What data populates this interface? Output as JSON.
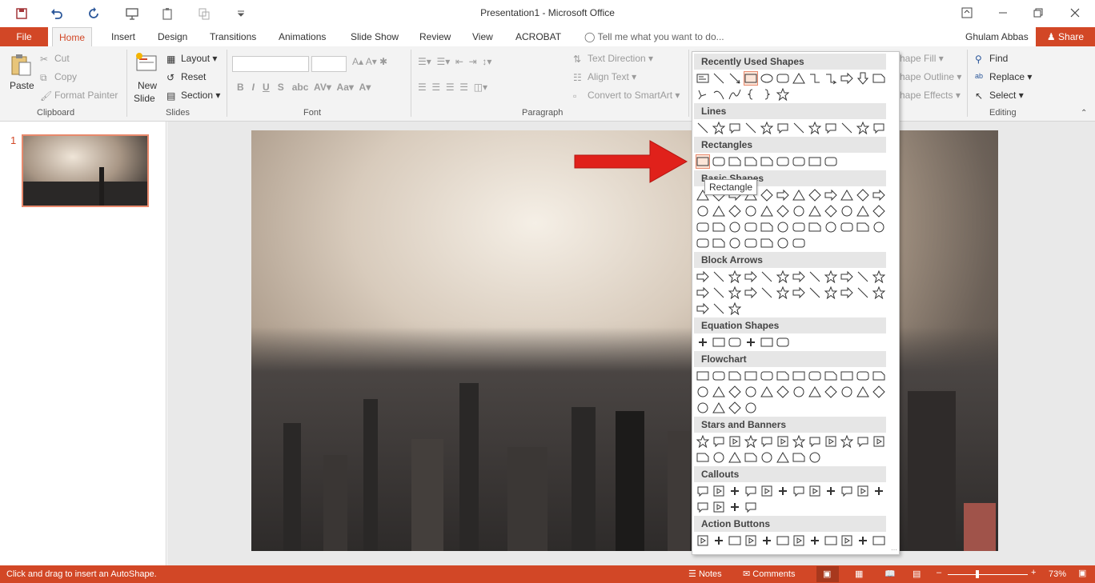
{
  "window": {
    "title": "Presentation1 - Microsoft Office",
    "user": "Ghulam Abbas",
    "share_label": "Share"
  },
  "tabs": [
    {
      "id": "file",
      "label": "File"
    },
    {
      "id": "home",
      "label": "Home"
    },
    {
      "id": "insert",
      "label": "Insert"
    },
    {
      "id": "design",
      "label": "Design"
    },
    {
      "id": "transitions",
      "label": "Transitions"
    },
    {
      "id": "animations",
      "label": "Animations"
    },
    {
      "id": "slideshow",
      "label": "Slide Show"
    },
    {
      "id": "review",
      "label": "Review"
    },
    {
      "id": "view",
      "label": "View"
    },
    {
      "id": "acrobat",
      "label": "ACROBAT"
    }
  ],
  "tell_me": "Tell me what you want to do...",
  "ribbon": {
    "clipboard": {
      "label": "Clipboard",
      "paste": "Paste",
      "cut": "Cut",
      "copy": "Copy",
      "format_painter": "Format Painter"
    },
    "slides": {
      "label": "Slides",
      "new_slide_1": "New",
      "new_slide_2": "Slide",
      "layout": "Layout",
      "reset": "Reset",
      "section": "Section"
    },
    "font": {
      "label": "Font"
    },
    "paragraph": {
      "label": "Paragraph",
      "text_direction": "Text Direction",
      "align_text": "Align Text",
      "smartart": "Convert to SmartArt"
    },
    "drawing": {
      "shape_fill": "hape Fill",
      "shape_outline": "hape Outline",
      "shape_effects": "hape Effects"
    },
    "editing": {
      "label": "Editing",
      "find": "Find",
      "replace": "Replace",
      "select": "Select"
    }
  },
  "slide_panel": {
    "slide_number": "1"
  },
  "shapes_gallery": {
    "sections": [
      {
        "title": "Recently Used Shapes",
        "rows": [
          12,
          6
        ]
      },
      {
        "title": "Lines",
        "rows": [
          12
        ]
      },
      {
        "title": "Rectangles",
        "rows": [
          9
        ]
      },
      {
        "title": "Basic Shapes",
        "rows": [
          12,
          12,
          12,
          7
        ]
      },
      {
        "title": "Block Arrows",
        "rows": [
          12,
          12,
          3
        ]
      },
      {
        "title": "Equation Shapes",
        "rows": [
          6
        ]
      },
      {
        "title": "Flowchart",
        "rows": [
          12,
          12,
          4
        ]
      },
      {
        "title": "Stars and Banners",
        "rows": [
          12,
          8
        ]
      },
      {
        "title": "Callouts",
        "rows": [
          12,
          4
        ]
      },
      {
        "title": "Action Buttons",
        "rows": [
          12
        ]
      }
    ],
    "tooltip": "Rectangle"
  },
  "status": {
    "message": "Click and drag to insert an AutoShape.",
    "notes": "Notes",
    "comments": "Comments",
    "zoom": "73%"
  },
  "colors": {
    "accent": "#d24726",
    "highlight": "#e8896c",
    "arrow": "#e0211b"
  }
}
